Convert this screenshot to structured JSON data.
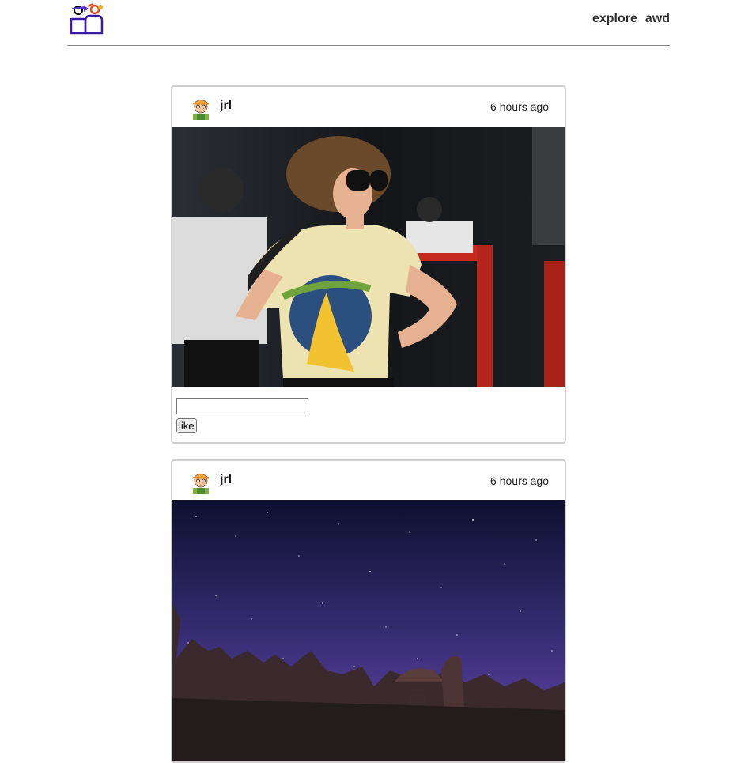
{
  "nav": {
    "logo_icon": "app-logo-icon",
    "explore_label": "explore",
    "user_label": "awd"
  },
  "posts": [
    {
      "username": "jrl",
      "timestamp": "6 hours ago",
      "avatar_icon": "user-avatar-icon",
      "comment_placeholder": "",
      "like_label": "like"
    },
    {
      "username": "jrl",
      "timestamp": "6 hours ago",
      "avatar_icon": "user-avatar-icon"
    }
  ],
  "colors": {
    "logo_purple": "#3b1aa8",
    "border": "#cfcfcf",
    "divider": "#8a8a8a"
  }
}
